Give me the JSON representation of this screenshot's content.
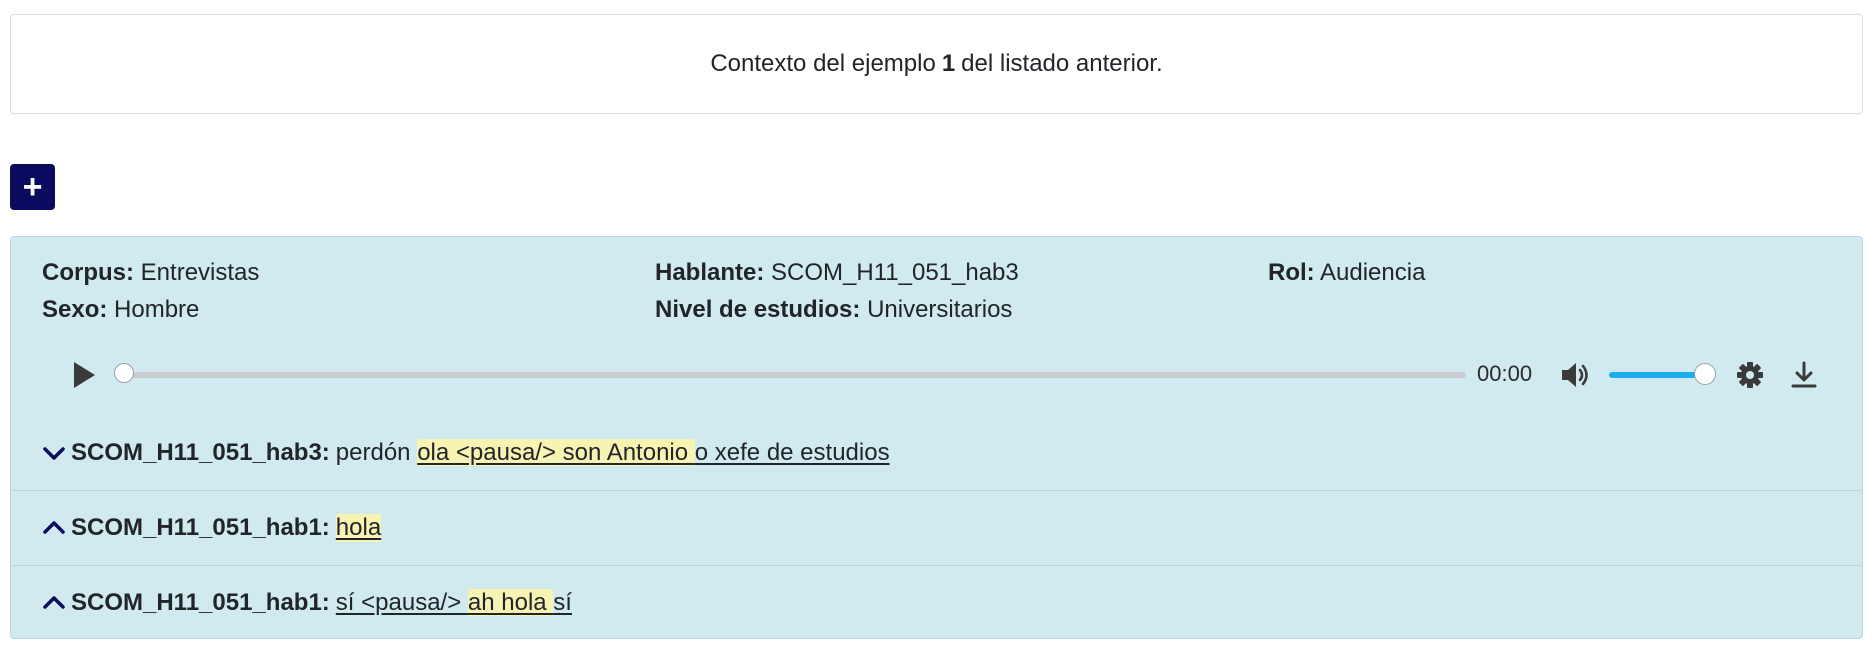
{
  "context": {
    "prefix": "Contexto del ejemplo",
    "number": "1",
    "suffix": "del listado anterior."
  },
  "add_button": {
    "label": "+"
  },
  "metadata": {
    "corpus_key": "Corpus:",
    "corpus_value": "Entrevistas",
    "hablante_key": "Hablante:",
    "hablante_value": "SCOM_H11_051_hab3",
    "rol_key": "Rol:",
    "rol_value": "Audiencia",
    "sexo_key": "Sexo:",
    "sexo_value": "Hombre",
    "nivel_key": "Nivel de estudios:",
    "nivel_value": "Universitarios"
  },
  "player": {
    "time": "00:00",
    "progress_fraction": 0.0,
    "volume_fraction": 1.0,
    "icons": [
      "play-icon",
      "volume-icon",
      "gear-icon",
      "download-icon"
    ]
  },
  "utterances": [
    {
      "chevron": "chevron-down-icon",
      "speaker": "SCOM_H11_051_hab3:",
      "before": "perdón",
      "highlight": "ola <pausa/> son Antonio ",
      "after": "o xefe de estudios"
    },
    {
      "chevron": "chevron-up-icon",
      "speaker": "SCOM_H11_051_hab1:",
      "before": "",
      "highlight": "hola",
      "after": ""
    },
    {
      "chevron": "chevron-up-icon",
      "speaker": "SCOM_H11_051_hab1:",
      "before": "sí <pausa/> ",
      "highlight": "ah hola ",
      "after": "sí"
    }
  ],
  "colors": {
    "accent_button": "#0a0a5e",
    "panel_background": "#d1eaef",
    "highlight": "#f6f3b3",
    "volume_fill": "#1aafec"
  }
}
